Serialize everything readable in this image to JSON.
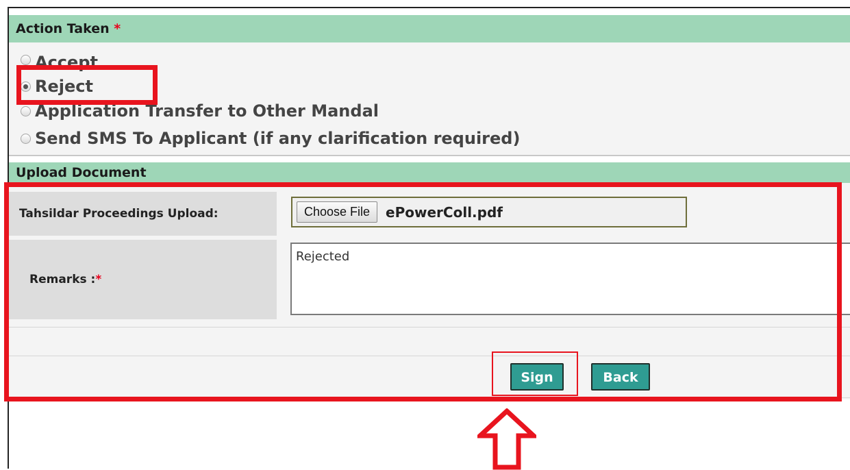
{
  "action_taken": {
    "title": "Action Taken",
    "required_mark": "*",
    "options": [
      {
        "label": "Accept",
        "selected": false
      },
      {
        "label": "Reject",
        "selected": true
      },
      {
        "label": "Application Transfer to Other Mandal",
        "selected": false
      },
      {
        "label": "Send SMS To Applicant (if any clarification required)",
        "selected": false
      }
    ]
  },
  "upload_document": {
    "title": "Upload Document",
    "tahsildar_label": "Tahsildar Proceedings Upload:",
    "choose_file_label": "Choose File",
    "file_name": "ePowerColl.pdf",
    "remarks_label": "Remarks :",
    "remarks_required_mark": "*",
    "remarks_value": "Rejected"
  },
  "buttons": {
    "sign": "Sign",
    "back": "Back"
  },
  "colors": {
    "section_header_bg": "#9ed6b7",
    "button_bg": "#2f9c92",
    "highlight_red": "#e8141e",
    "required_red": "#e8001c"
  }
}
